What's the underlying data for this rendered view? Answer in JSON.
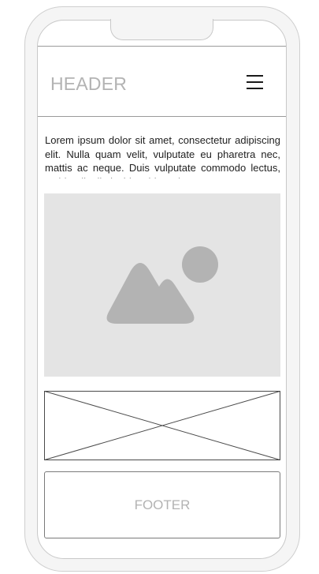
{
  "header": {
    "title": "HEADER",
    "menu_icon": "hamburger-menu-icon"
  },
  "content": {
    "paragraph": "Lorem ipsum dolor sit amet, consectetur adipiscing elit. Nulla quam velit, vulputate eu pharetra nec, mattis ac neque. Duis vulputate commodo lectus, ac blandit elit tincidunt id. Sed"
  },
  "image_placeholder": {
    "icon": "image-icon"
  },
  "footer": {
    "label": "FOOTER"
  },
  "colors": {
    "placeholder_text": "#b3b3b3",
    "image_bg": "#e4e4e4",
    "image_glyph": "#b3b3b3",
    "shell": "#f5f5f5"
  }
}
